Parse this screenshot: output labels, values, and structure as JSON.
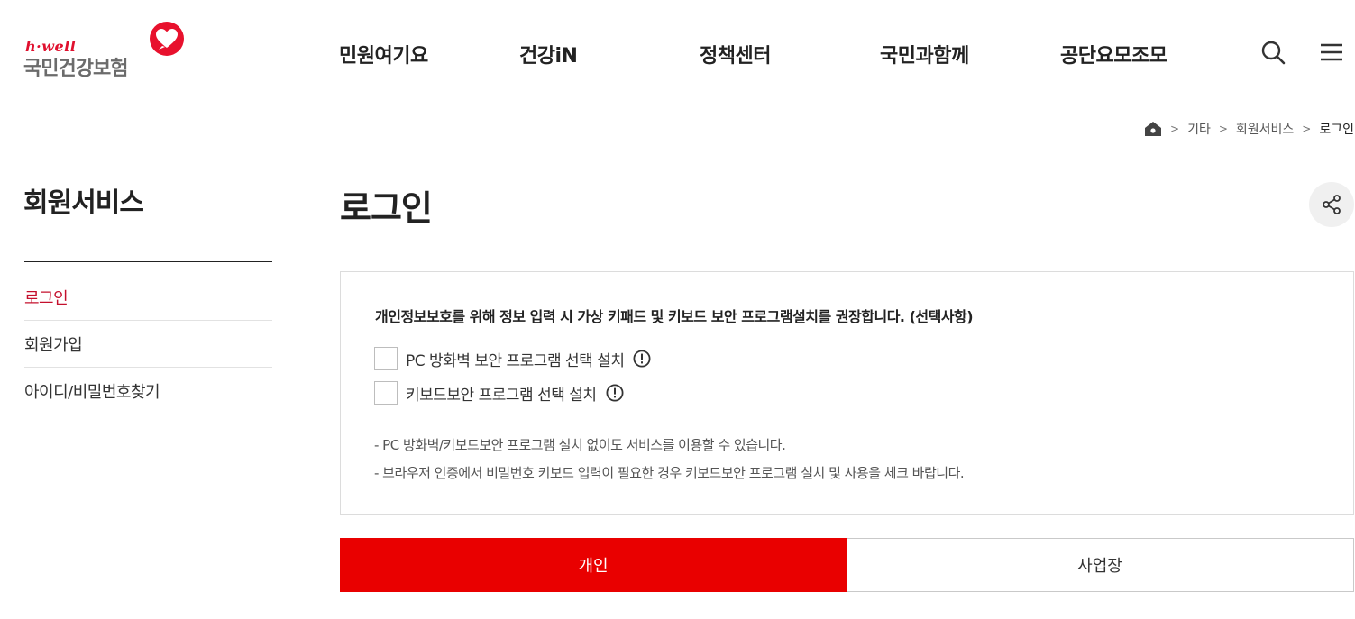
{
  "brand": {
    "tagline": "h·well",
    "name": "국민건강보험",
    "accent_color": "#e8112d"
  },
  "gnb": {
    "items": [
      {
        "label": "민원여기요"
      },
      {
        "label": "건강iN"
      },
      {
        "label": "정책센터"
      },
      {
        "label": "국민과함께"
      },
      {
        "label": "공단요모조모"
      }
    ],
    "search_icon": "search-icon",
    "menu_icon": "hamburger-menu-icon"
  },
  "breadcrumb": {
    "home_icon": "home-icon",
    "items": [
      "기타",
      "회원서비스",
      "로그인"
    ]
  },
  "lnb": {
    "title": "회원서비스",
    "items": [
      {
        "label": "로그인",
        "active": true
      },
      {
        "label": "회원가입",
        "active": false
      },
      {
        "label": "아이디/비밀번호찾기",
        "active": false
      }
    ],
    "active_color": "#c4102d"
  },
  "page": {
    "title": "로그인",
    "share_icon": "share-icon"
  },
  "notice": {
    "heading": "개인정보보호를 위해 정보 입력 시 가상 키패드 및 키보드 보안 프로그램설치를 권장합니다. (선택사항)",
    "options": [
      {
        "label": "PC 방화벽 보안 프로그램 선택 설치",
        "checked": false
      },
      {
        "label": "키보드보안 프로그램 선택 설치",
        "checked": false
      }
    ],
    "notes": [
      "-  PC 방화벽/키보드보안 프로그램 설치 없이도 서비스를 이용할 수 있습니다.",
      "-  브라우저 인증에서 비밀번호 키보드 입력이 필요한 경우 키보드보안 프로그램 설치 및 사용을 체크 바랍니다."
    ]
  },
  "tabs": {
    "items": [
      {
        "label": "개인",
        "selected": true
      },
      {
        "label": "사업장",
        "selected": false
      }
    ],
    "selected_color": "#e90000"
  }
}
